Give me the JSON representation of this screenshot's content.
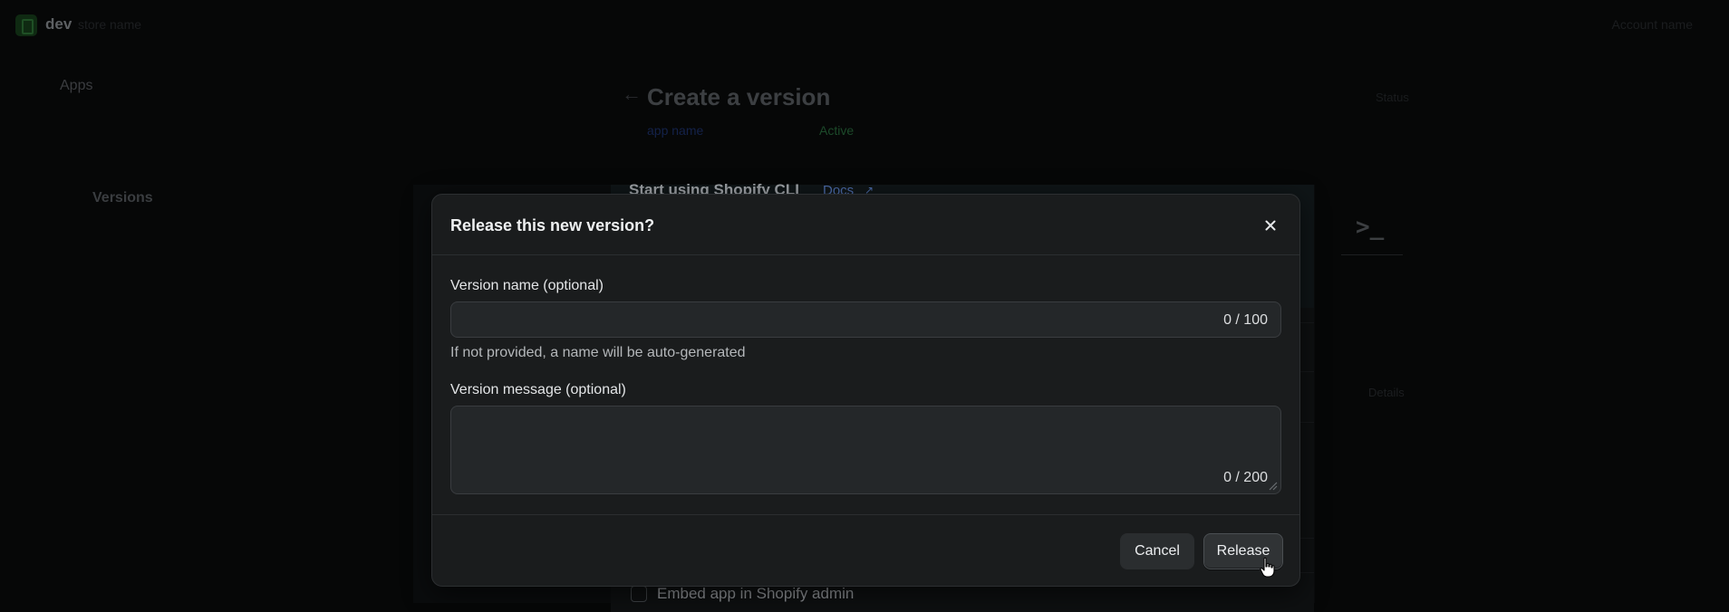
{
  "topbar": {
    "store_name": "dev",
    "store_sub": "store name",
    "account_name": "Account name"
  },
  "sidebar": {
    "apps_label": "Apps",
    "versions_label": "Versions"
  },
  "page": {
    "title": "Create a version",
    "app_link": "app name",
    "status": "Active",
    "side_label": "Status",
    "side_hint": "Details"
  },
  "background_card": {
    "title": "Start using Shopify CLI",
    "docs_label": "Docs",
    "embed_label": "Embed app in Shopify admin"
  },
  "modal": {
    "title": "Release this new version?",
    "close_icon": "close-icon",
    "name_label": "Version name (optional)",
    "name_value": "",
    "name_counter": "0 / 100",
    "name_help": "If not provided, a name will be auto-generated",
    "message_label": "Version message (optional)",
    "message_value": "",
    "message_counter": "0 / 200",
    "cancel_label": "Cancel",
    "release_label": "Release"
  },
  "colors": {
    "modal_bg": "#1a1c1d",
    "input_bg": "#242729",
    "button_bg": "#2a2d2f",
    "text_primary": "#eef0f1",
    "link_blue": "#4b6aa8"
  }
}
